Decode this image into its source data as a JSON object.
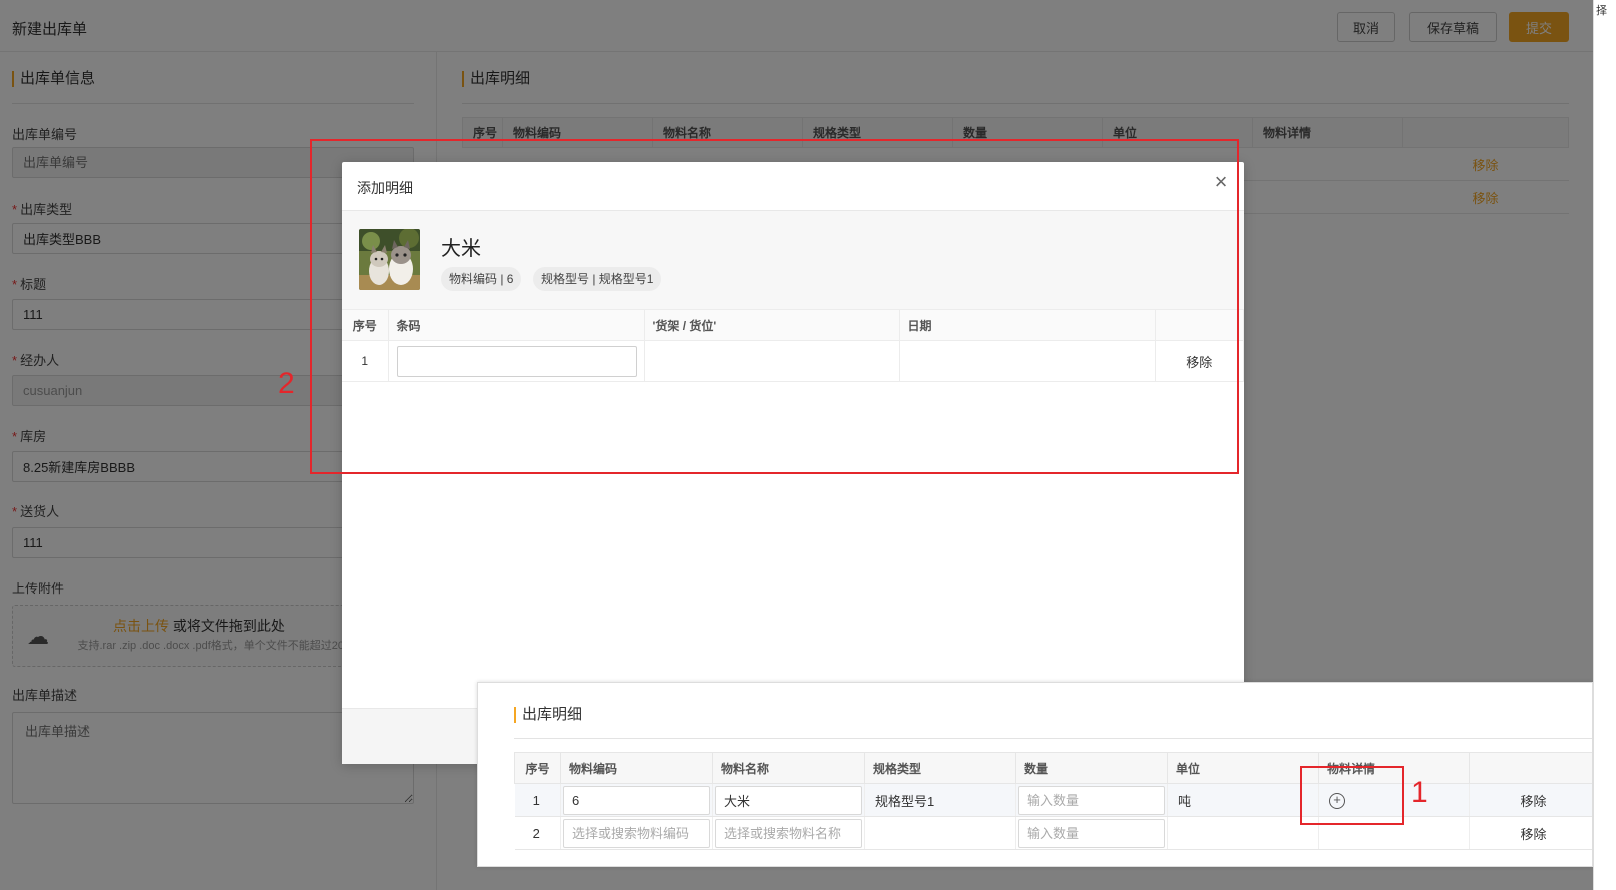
{
  "header": {
    "title": "新建出库单",
    "buttons": {
      "cancel": "取消",
      "save_draft": "保存草稿",
      "submit": "提交"
    }
  },
  "form": {
    "section_title": "出库单信息",
    "order_no": {
      "label": "出库单编号",
      "placeholder": "出库单编号"
    },
    "type": {
      "label": "出库类型",
      "value": "出库类型BBB"
    },
    "title": {
      "label": "标题",
      "value": "111"
    },
    "handler": {
      "label": "经办人",
      "value": "cusuanjun"
    },
    "warehouse": {
      "label": "库房",
      "value": "8.25新建库房BBBB"
    },
    "shipper": {
      "label": "送货人",
      "value": "111"
    },
    "attachment": {
      "label": "上传附件",
      "upload_link": "点击上传",
      "upload_text": "或将文件拖到此处",
      "hint": "支持.rar .zip .doc .docx .pdf格式，单个文件不能超过20MB"
    },
    "description": {
      "label": "出库单描述",
      "placeholder": "出库单描述"
    }
  },
  "details": {
    "section_title": "出库明细",
    "columns": [
      "序号",
      "物料编码",
      "物料名称",
      "规格类型",
      "数量",
      "单位",
      "物料详情",
      ""
    ],
    "remove_label": "移除",
    "rows": [
      {
        "index": "1",
        "code": "6",
        "name": "大米",
        "spec": "规格型号1",
        "qty_placeholder": "输入数量",
        "unit": "吨"
      },
      {
        "index": "2",
        "code_placeholder": "选择或搜索物料编码",
        "name_placeholder": "选择或搜索物料名称",
        "spec": "",
        "qty_placeholder": "输入数量",
        "unit": ""
      }
    ]
  },
  "modal": {
    "title": "添加明细",
    "product_name": "大米",
    "tags": [
      "物料编码 | 6",
      "规格型号 | 规格型号1"
    ],
    "columns": [
      "序号",
      "条码",
      "'货架 / 货位'",
      "日期",
      ""
    ],
    "rows": [
      {
        "index": "1",
        "remove": "移除"
      }
    ]
  },
  "annotations": {
    "label_1": "1",
    "label_2": "2"
  },
  "side_strip": {
    "text": "择"
  },
  "colors": {
    "accent": "#f5a623",
    "annotation": "#e4262b"
  }
}
